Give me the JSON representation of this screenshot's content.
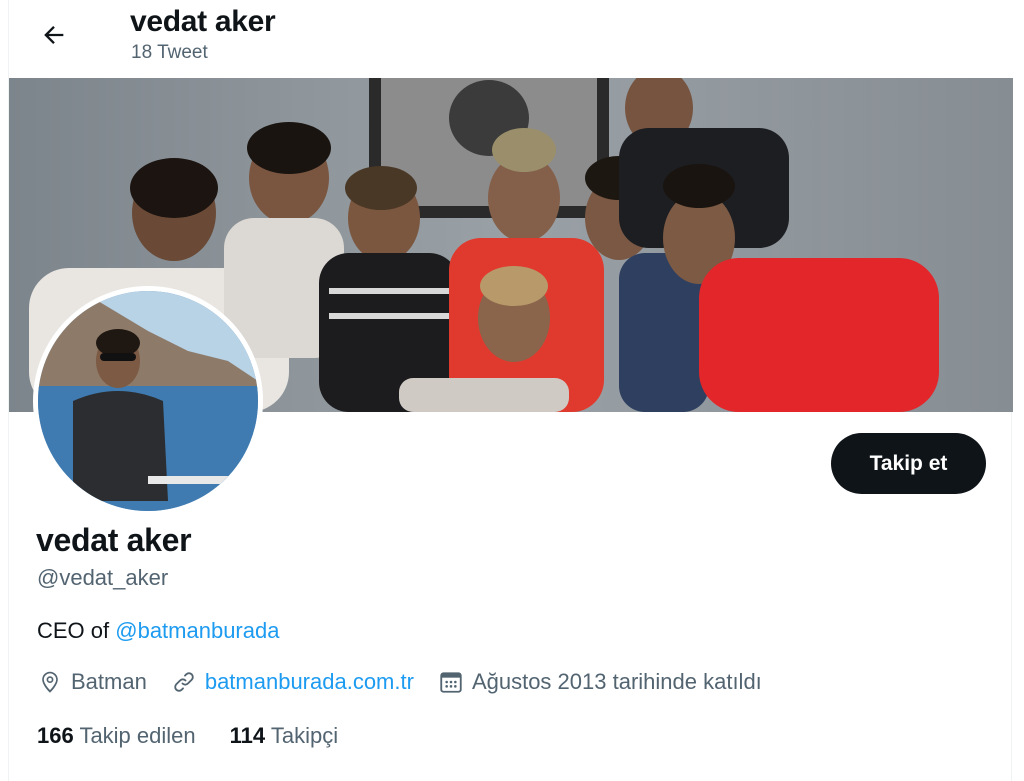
{
  "header": {
    "title": "vedat aker",
    "tweet_count": "18 Tweet"
  },
  "profile": {
    "name": "vedat aker",
    "handle": "@vedat_aker",
    "bio_prefix": "CEO of ",
    "bio_mention": "@batmanburada",
    "follow_label": "Takip et",
    "location": "Batman",
    "website": "batmanburada.com.tr",
    "joined": "Ağustos 2013 tarihinde katıldı"
  },
  "stats": {
    "following_count": "166",
    "following_label": "Takip edilen",
    "followers_count": "114",
    "followers_label": "Takipçi"
  },
  "icons": {
    "back": "arrow-left-icon",
    "location": "location-pin-icon",
    "website": "link-icon",
    "joined": "calendar-icon"
  },
  "colors": {
    "accent": "#1d9bf0",
    "text": "#0f1419",
    "muted": "#536471",
    "button": "#0f1419"
  }
}
